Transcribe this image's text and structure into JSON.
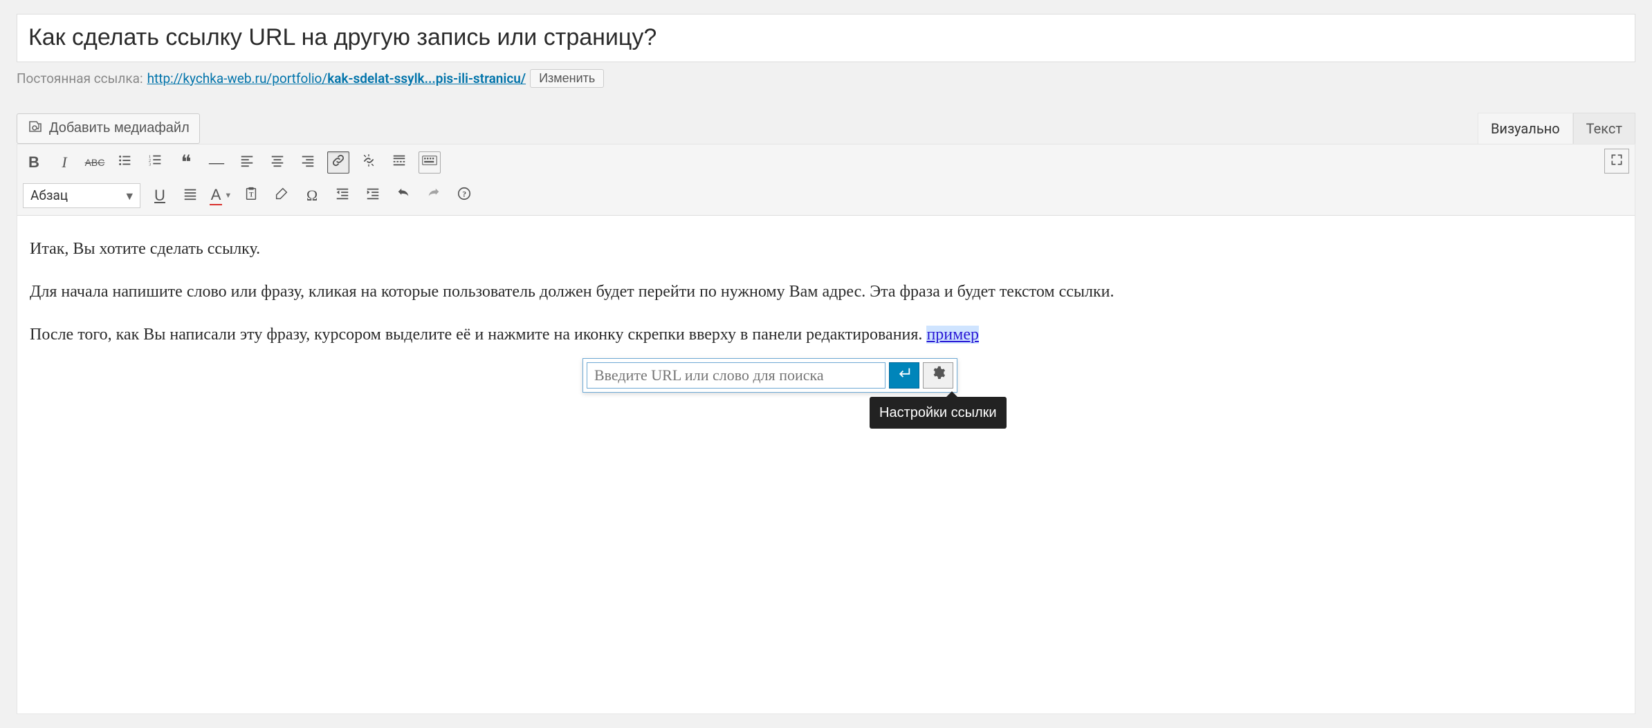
{
  "title": "Как сделать ссылку URL на другую запись или страницу?",
  "permalink": {
    "label": "Постоянная ссылка:",
    "base": "http://kychka-web.ru/portfolio/",
    "slug": "kak-sdelat-ssylk...pis-ili-stranicu/",
    "edit_label": "Изменить"
  },
  "media_button": "Добавить медиафайл",
  "tabs": {
    "visual": "Визуально",
    "text": "Текст"
  },
  "format_select": "Абзац",
  "content": {
    "p1": "Итак, Вы хотите сделать ссылку.",
    "p2": "Для начала напишите слово или фразу, кликая на которые пользователь должен будет перейти по нужному Вам адрес. Эта фраза и будет текстом ссылки.",
    "p3_prefix": "После того, как Вы написали эту фразу, курсором выделите её и нажмите на иконку скрепки вверху в панели редактирования. ",
    "p3_link": "пример"
  },
  "link_popup": {
    "placeholder": "Введите URL или слово для поиска",
    "tooltip": "Настройки ссылки"
  },
  "icons": {
    "bold": "B",
    "italic": "I",
    "strike": "ABC",
    "ul": "list",
    "ol": "olist",
    "quote": "❝",
    "hr": "—",
    "align_left": "al",
    "align_center": "ac",
    "align_right": "ar",
    "link": "link",
    "unlink": "unlink",
    "more": "more",
    "toolbar": "kb",
    "underline": "U",
    "justify": "aj",
    "color": "A",
    "paste": "paste",
    "clear": "clear",
    "omega": "Ω",
    "outdent": "out",
    "indent": "in",
    "undo": "undo",
    "redo": "redo",
    "help": "?"
  }
}
